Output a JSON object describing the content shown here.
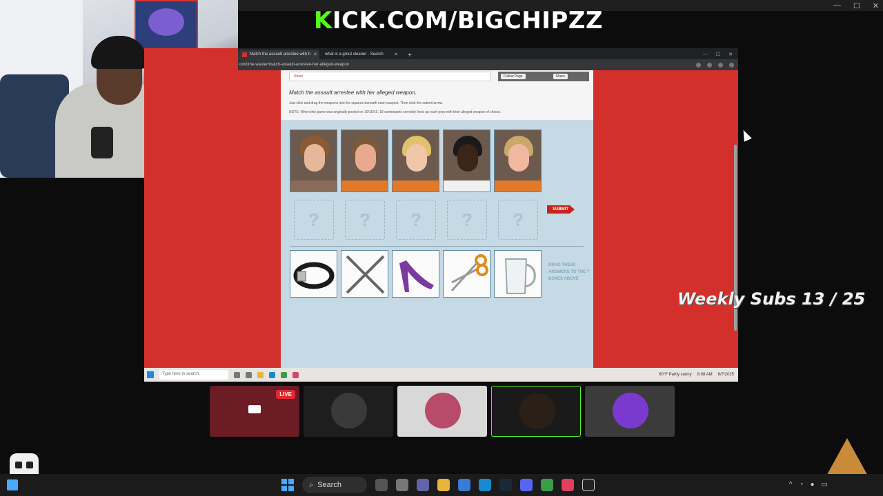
{
  "overlay": {
    "kick_prefix": "K",
    "kick_rest": "ICK.COM/BIGCHIPZZ",
    "weekly_subs": "Weekly Subs  13 / 25",
    "brand_color": "#53fc18"
  },
  "browser": {
    "tabs": [
      {
        "label": "Match the assault arrestee with h",
        "active": true
      },
      {
        "label": "what is a grout cleaner - Search",
        "active": false
      }
    ],
    "new_tab": "+",
    "url": "om/time-waster/match-assault-arrestee-her-alleged-weapon"
  },
  "page": {
    "share_label": "Share",
    "follow_label": "Follow Page",
    "fb_share_label": "Share",
    "title": "Match the assault arrestee with her alleged weapon.",
    "instructions": "Just click and drag the weapons into the squares beneath each suspect. Then click the submit arrow.",
    "note": "NOTE: When this game was originally posted on 10/15/10, 18 contestants correctly lined up each perp with their alleged weapon of choice.",
    "slot_mark": "?",
    "submit_label": "SUBMIT",
    "drag_hint": "DRAG THESE ANSWERS TO THE ? BOXES ABOVE",
    "suspects": [
      "suspect-1",
      "suspect-2",
      "suspect-3",
      "suspect-4",
      "suspect-5"
    ],
    "weapons": [
      "belt-icon",
      "lug-wrench-icon",
      "high-heel-icon",
      "scissors-icon",
      "pitcher-icon"
    ]
  },
  "inner_taskbar": {
    "search_placeholder": "Type here to search",
    "weather": "60°F  Partly sunny",
    "time": "8:08 AM",
    "date": "6/7/2025"
  },
  "call": {
    "live_badge": "LIVE"
  },
  "taskbar": {
    "search_label": "Search"
  }
}
